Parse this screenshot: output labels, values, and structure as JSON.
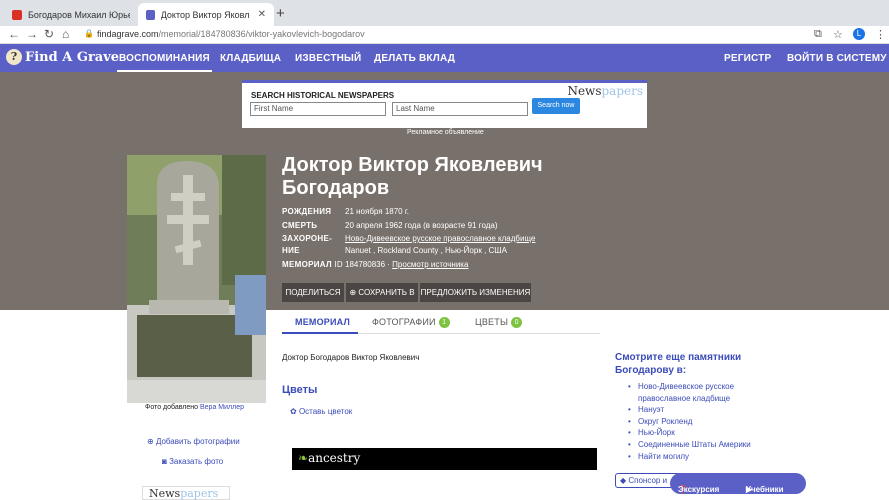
{
  "browser": {
    "tabs": [
      {
        "title": "Богодаров Михаил Юрьевич - ",
        "active": false
      },
      {
        "title": "Доктор Виктор Яковлевич Бо",
        "active": true
      }
    ],
    "url_host": "findagrave.com",
    "url_path": "/memorial/184780836/viktor-yakovlevich-bogodarov",
    "profile_initial": "L"
  },
  "nav": {
    "logo": "Find A Grave",
    "items": [
      "ВОСПОМИНАНИЯ",
      "КЛАДБИЩА",
      "ИЗВЕСТНЫЙ",
      "ДЕЛАТЬ ВКЛАД"
    ],
    "register": "РЕГИСТР",
    "login": "ВОЙТИ В СИСТЕМУ"
  },
  "ad": {
    "title": "SEARCH HISTORICAL NEWSPAPERS",
    "brand_a": "News",
    "brand_b": "papers",
    "first_name_placeholder": "First Name",
    "last_name_placeholder": "Last Name",
    "button": "Search now",
    "label": "Рекламное объявление"
  },
  "memorial": {
    "name": "Доктор Виктор Яковлевич Богодаров",
    "birth_label": "РОЖДЕНИЯ",
    "birth_value": "21 ноября 1870 г.",
    "death_label": "СМЕРТЬ",
    "death_value": "20 апреля 1962 года (в возрасте 91 года)",
    "burial_label_1": "ЗАХОРОНЕ-",
    "burial_label_2": "НИЕ",
    "burial_cemetery": "Ново-Дивеевское русское православное кладбище",
    "burial_location": "Nanuet , Rockland County , Нью-Йорк , США",
    "memorial_id_label": "МЕМОРИАЛ",
    "memorial_id_suffix": "ID",
    "memorial_id": "184780836 ·",
    "view_source": "Просмотр источника",
    "share": "ПОДЕЛИТЬСЯ",
    "save": "СОХРАНИТЬ В",
    "suggest": "ПРЕДЛОЖИТЬ ИЗМЕНЕНИЯ"
  },
  "tabs": {
    "memorial": "МЕМОРИАЛ",
    "photos": "ФОТОГРАФИИ",
    "photos_count": "1",
    "flowers": "ЦВЕТЫ",
    "flowers_count": "0"
  },
  "content": {
    "bio": "Доктор Богодаров Виктор Яковлевич",
    "flowers_title": "Цветы",
    "leave_flower": "Оставь цветок",
    "ancestry": "ancestry"
  },
  "sidebar_left": {
    "photo_added_by": "Фото добавлено",
    "photo_author": "Вера Миллер",
    "add_photos": "Добавить фотографии",
    "order_photo": "Заказать фото"
  },
  "sidebar_right": {
    "title": "Смотрите еще памятники Богодарову в:",
    "links": [
      "Ново-Дивеевское русское православное кладбище",
      "Нануэт",
      "Округ Рокленд",
      "Нью-Йорк",
      "Соединенные Штаты Америки",
      "Найти могилу"
    ],
    "sponsor": "Спонсор и",
    "tour": "Экскурсия",
    "tutorials": "Учебники"
  },
  "colors": {
    "nav_bg": "#5b60c6",
    "hero_bg": "#78706a",
    "link": "#3b4cb8",
    "badge": "#7ec242"
  }
}
